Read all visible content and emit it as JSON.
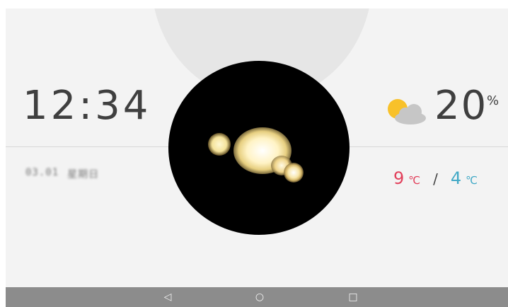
{
  "clock": {
    "time": "12:34"
  },
  "date": {
    "day": "03.01",
    "weekday": "星期日"
  },
  "weather": {
    "icon": "partly-cloudy-icon",
    "current_temp": "20",
    "current_unit": "%",
    "high_temp": "9",
    "high_unit": "℃",
    "separator": "/",
    "low_temp": "4",
    "low_unit": "℃"
  },
  "nav": {
    "back_icon": "◁",
    "home_icon": "○",
    "recents_icon": "□"
  },
  "colors": {
    "high": "#e2405b",
    "low": "#42a9c6",
    "sun": "#f8c12a",
    "cloud": "#c6c6c6"
  }
}
